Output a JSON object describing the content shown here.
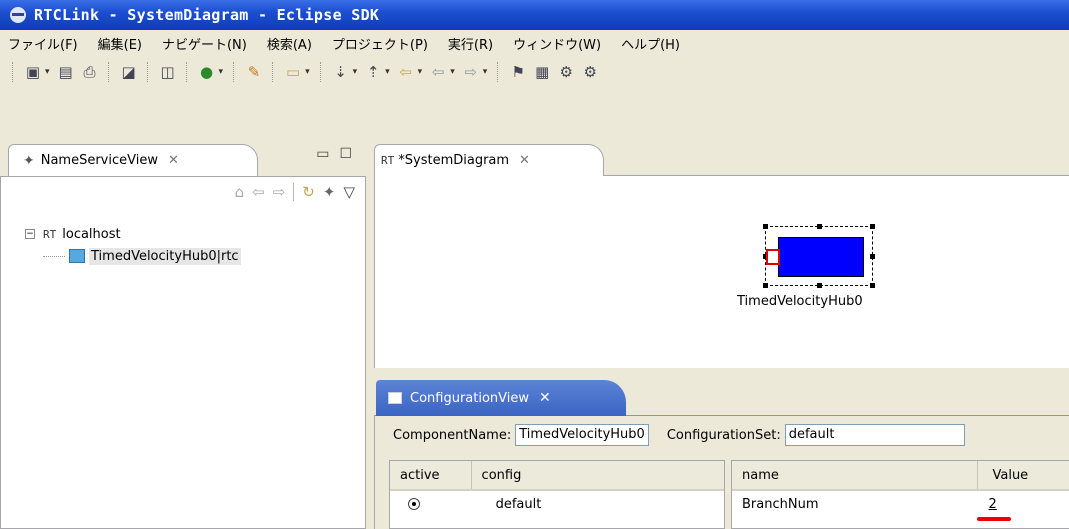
{
  "window": {
    "title": "RTCLink - SystemDiagram - Eclipse SDK"
  },
  "menu": [
    "ファイル(F)",
    "編集(E)",
    "ナビゲート(N)",
    "検索(A)",
    "プロジェクト(P)",
    "実行(R)",
    "ウィンドウ(W)",
    "ヘルプ(H)"
  ],
  "left_view": {
    "tab_label": "NameServiceView",
    "tree": {
      "host": "localhost",
      "component": "TimedVelocityHub0|rtc",
      "rt_badge": "RT"
    }
  },
  "diagram": {
    "tab_label": "*SystemDiagram",
    "rt_badge": "RT",
    "component_label": "TimedVelocityHub0",
    "component_color": "#0000ff",
    "port_color": "#dd0000"
  },
  "config_view": {
    "tab_label": "ConfigurationView",
    "component_name_label": "ComponentName:",
    "component_name_value": "TimedVelocityHub0",
    "configuration_set_label": "ConfigurationSet:",
    "configuration_set_value": "default",
    "sets_table": {
      "headers": [
        "active",
        "config"
      ],
      "rows": [
        {
          "active": true,
          "config": "default"
        }
      ]
    },
    "params_table": {
      "headers": [
        "name",
        "Value"
      ],
      "rows": [
        {
          "name": "BranchNum",
          "value": "2"
        }
      ]
    }
  },
  "colors": {
    "title_bar": "#1c4fd0",
    "config_tab": "#3b64c4",
    "highlight_underline": "#ee0000"
  }
}
